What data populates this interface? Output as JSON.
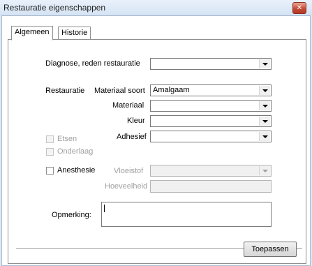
{
  "window": {
    "title": "Restauratie eigenschappen",
    "close_glyph": "✕"
  },
  "tabs": [
    {
      "label": "Algemeen",
      "active": true
    },
    {
      "label": "Historie",
      "active": false
    }
  ],
  "form": {
    "diagnose_label": "Diagnose, reden restauratie",
    "diagnose_value": "",
    "restauratie_label": "Restauratie",
    "materiaal_soort_label": "Materiaal soort",
    "materiaal_soort_value": "Amalgaam",
    "materiaal_label": "Materiaal",
    "materiaal_value": "",
    "kleur_label": "Kleur",
    "kleur_value": "",
    "adhesief_label": "Adhesief",
    "adhesief_value": "",
    "etsen_label": "Etsen",
    "etsen_checked": false,
    "onderlaag_label": "Onderlaag",
    "onderlaag_checked": false,
    "anesthesie_label": "Anesthesie",
    "anesthesie_checked": false,
    "vloeistof_label": "Vloeistof",
    "vloeistof_value": "",
    "hoeveelheid_label": "Hoeveelheid",
    "hoeveelheid_value": "",
    "opmerking_label": "Opmerking:",
    "opmerking_value": ""
  },
  "buttons": {
    "apply_label": "Toepassen"
  },
  "colors": {
    "title_bg": "#dfe9f5",
    "close_button": "#c64a35",
    "disabled_text": "#a0a0a0"
  }
}
